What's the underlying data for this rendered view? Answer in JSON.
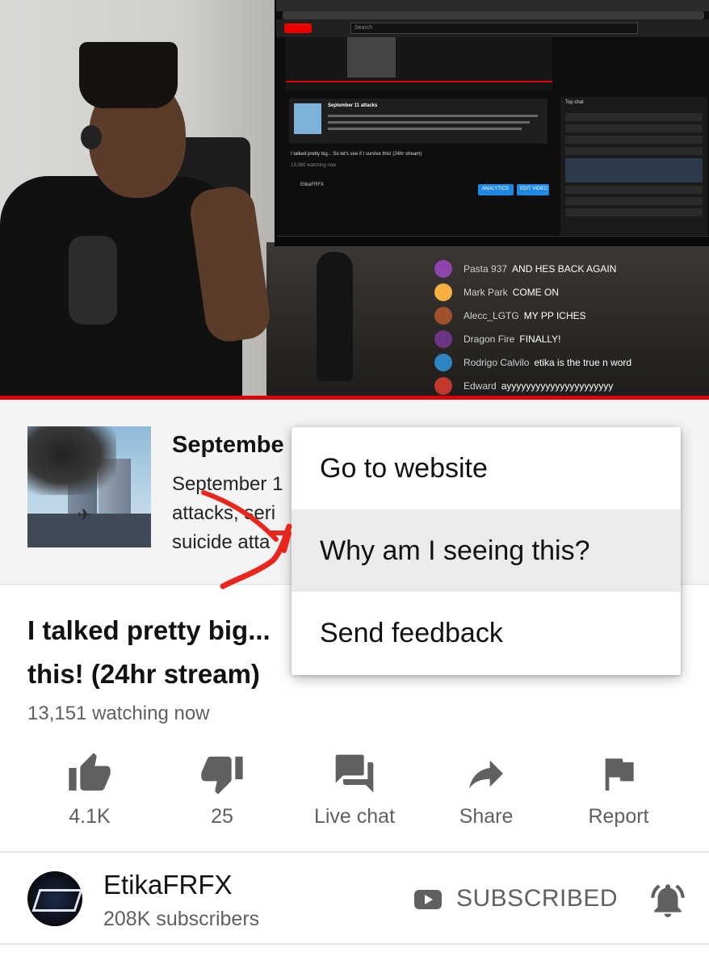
{
  "overlay_chat": [
    {
      "name": "Pasta 937",
      "message": "AND HES BACK AGAIN",
      "color": "#8e44ad"
    },
    {
      "name": "Mark Park",
      "message": "COME ON",
      "color": "#f5b041"
    },
    {
      "name": "Alecc_LGTG",
      "message": "MY PP ICHES",
      "color": "#a0522d"
    },
    {
      "name": "Dragon Fire",
      "message": "FINALLY!",
      "color": "#6c3483"
    },
    {
      "name": "Rodrigo Calvilo",
      "message": "etika is the true n word",
      "color": "#2e86c1"
    },
    {
      "name": "Edward",
      "message": "ayyyyyyyyyyyyyyyyyyyyyy",
      "color": "#c0392b"
    }
  ],
  "embedded_screen": {
    "search_placeholder": "Search",
    "card_title": "September 11 attacks",
    "video_title": "I talked pretty big... So let's see if I survive this! (24hr stream)",
    "watching": "13,080 watching now",
    "chat_header": "Top chat",
    "analytics_label": "ANALYTICS",
    "edit_label": "EDIT VIDEO",
    "channel": "EtikaFRFX"
  },
  "info_card": {
    "title": "Septembe",
    "description": "September 1\nattacks, seri\nsuicide atta"
  },
  "context_menu": {
    "items": [
      "Go to website",
      "Why am I seeing this?",
      "Send feedback"
    ]
  },
  "video": {
    "title": "I talked pretty big...\nthis! (24hr stream)",
    "watching": "13,151 watching now"
  },
  "actions": {
    "like": "4.1K",
    "dislike": "25",
    "live_chat": "Live chat",
    "share": "Share",
    "report": "Report"
  },
  "channel": {
    "name": "EtikaFRFX",
    "subscribers": "208K subscribers",
    "subscribe_state": "SUBSCRIBED"
  },
  "colors": {
    "accent_red": "#e00000",
    "annotation_red": "#e8261c",
    "icon_gray": "#606060"
  },
  "icons": [
    "thumb-up-icon",
    "thumb-down-icon",
    "live-chat-icon",
    "share-icon",
    "flag-icon",
    "youtube-icon",
    "bell-icon"
  ]
}
